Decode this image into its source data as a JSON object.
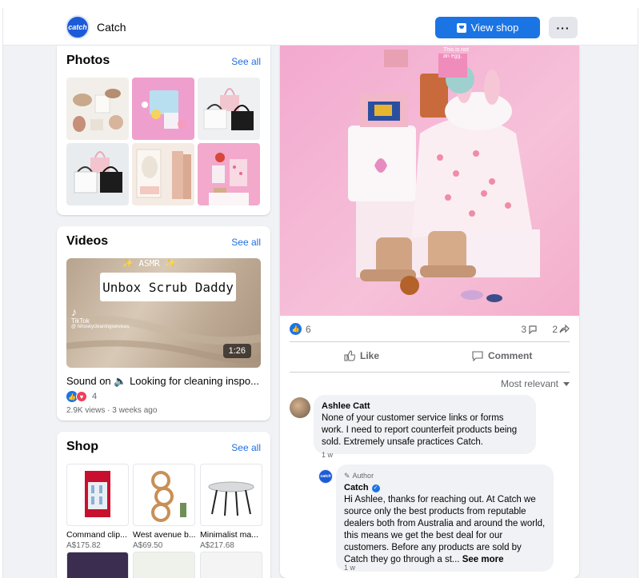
{
  "header": {
    "logo_text": "catch",
    "page_name": "Catch",
    "view_shop_label": "View shop",
    "more_label": "···"
  },
  "photos": {
    "title": "Photos",
    "see_all": "See all"
  },
  "videos": {
    "title": "Videos",
    "see_all": "See all",
    "overlay_top": "✨ ASMR ✨",
    "overlay_banner": "Unbox Scrub Daddy",
    "tiktok_label": "TikTok",
    "tiktok_handle": "@ hihoskycleaningservices",
    "duration": "1:26",
    "caption": "Sound on 🔈 Looking for cleaning inspo...",
    "reaction_count": "4",
    "meta": "2.9K views · 3 weeks ago"
  },
  "shop": {
    "title": "Shop",
    "see_all": "See all",
    "items": [
      {
        "name": "Command clip...",
        "price": "A$175.82"
      },
      {
        "name": "West avenue b...",
        "price": "A$69.50"
      },
      {
        "name": "Minimalist ma...",
        "price": "A$217.68"
      }
    ]
  },
  "post": {
    "image_text": "This is not an egg.",
    "reactions_count": "6",
    "comments_count": "3",
    "shares_count": "2",
    "like_label": "Like",
    "comment_label": "Comment",
    "sort_label": "Most relevant",
    "comments": [
      {
        "author": "Ashlee Catt",
        "text": "None of your customer service links or forms work. I need to report counterfeit products being sold. Extremely unsafe practices Catch.",
        "time": "1 w"
      },
      {
        "badge": "Author",
        "author": "Catch",
        "text": "Hi Ashlee, thanks for reaching out. At Catch we source only the best products from reputable dealers both from Australia and around the world, this means we get the best deal for our customers. Before any products are sold by Catch they go through a st...",
        "see_more": "See more",
        "time": "1 w"
      }
    ]
  },
  "colors": {
    "accent": "#1b74e4",
    "link": "#216fdb",
    "background": "#f0f2f5"
  }
}
